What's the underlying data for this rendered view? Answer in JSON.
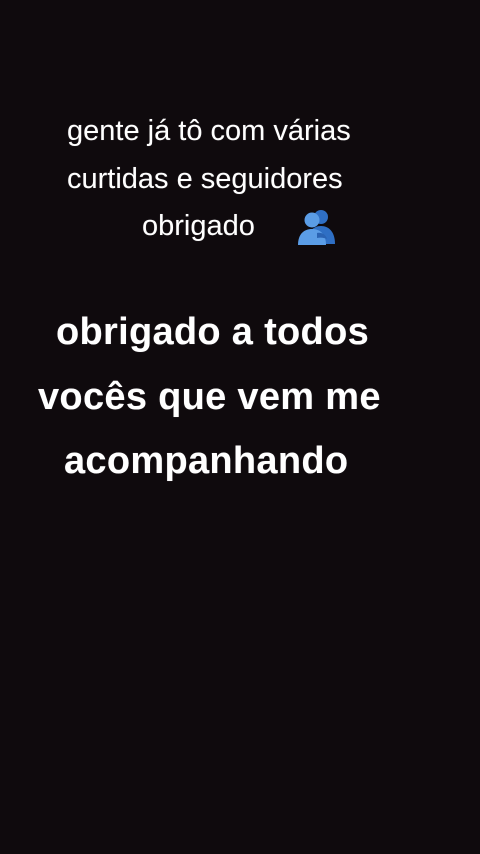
{
  "caption_small": {
    "line1": "gente já tô com várias",
    "line2": "curtidas e seguidores",
    "line3": "obrigado"
  },
  "caption_big": {
    "line1": "obrigado a todos",
    "line2": "vocês que vem me",
    "line3": "acompanhando"
  },
  "emoji": {
    "icon": "people-hugging-icon",
    "color": "#3b7fd6"
  },
  "colors": {
    "background": "#0f0a0d",
    "text": "#ffffff"
  }
}
